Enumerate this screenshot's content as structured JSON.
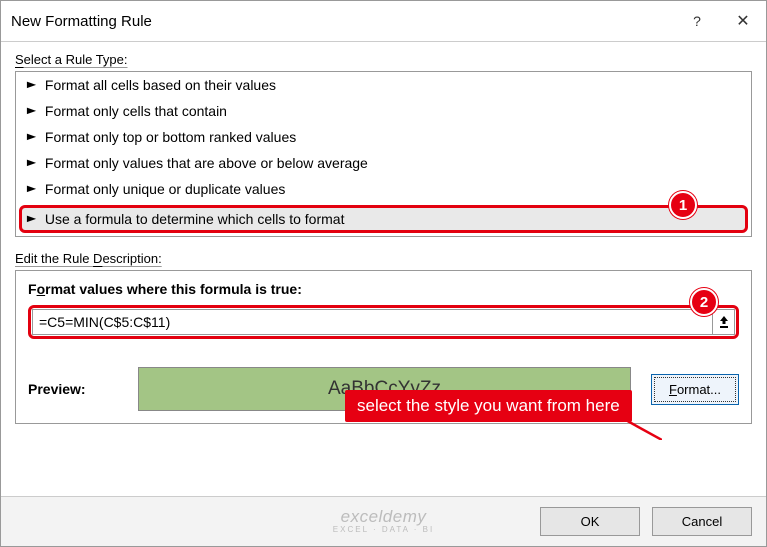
{
  "titlebar": {
    "title": "New Formatting Rule"
  },
  "labels": {
    "select_rule_type": "Select a Rule Type:",
    "edit_rule_desc": "Edit the Rule Description:",
    "formula_heading": "Format values where this formula is true:",
    "preview": "Preview:",
    "format_btn": "Format...",
    "ok": "OK",
    "cancel": "Cancel"
  },
  "rule_types": [
    "Format all cells based on their values",
    "Format only cells that contain",
    "Format only top or bottom ranked values",
    "Format only values that are above or below average",
    "Format only unique or duplicate values",
    "Use a formula to determine which cells to format"
  ],
  "formula": "=C5=MIN(C$5:C$11)",
  "preview_sample": "AaBbCcYyZz",
  "annotation": {
    "badge1": "1",
    "badge2": "2",
    "tooltip": "select the style you want from here"
  },
  "watermark": {
    "line1": "exceldemy",
    "line2": "EXCEL · DATA · BI"
  }
}
